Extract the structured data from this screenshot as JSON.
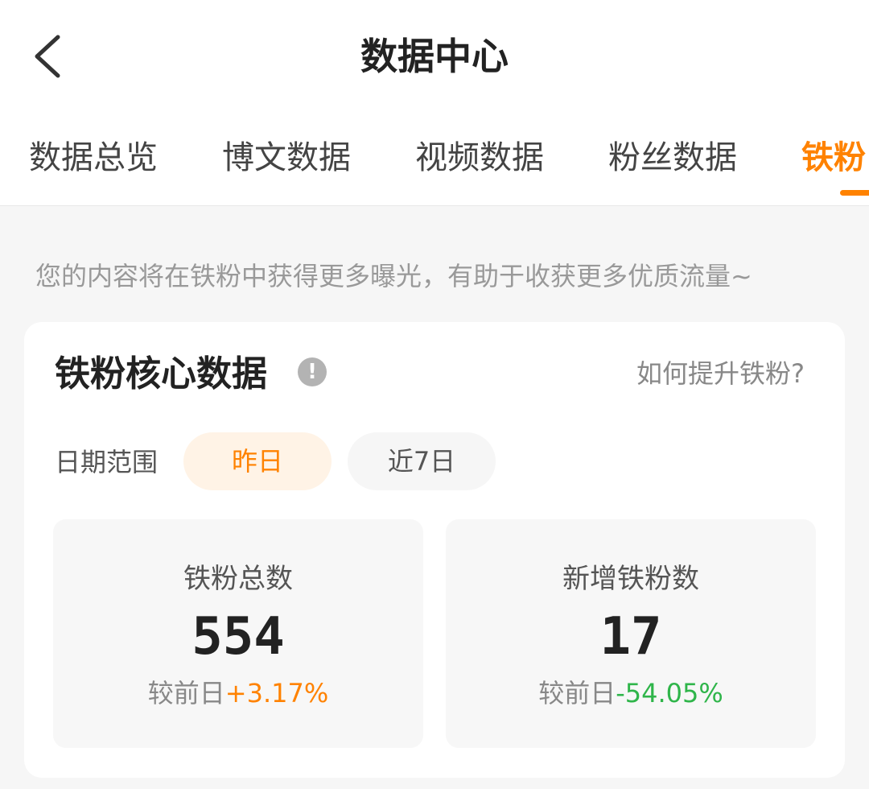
{
  "header": {
    "title": "数据中心",
    "back_icon": "chevron-left-icon"
  },
  "tabs": [
    {
      "label": "数据总览",
      "active": false
    },
    {
      "label": "博文数据",
      "active": false
    },
    {
      "label": "视频数据",
      "active": false
    },
    {
      "label": "粉丝数据",
      "active": false
    },
    {
      "label": "铁粉",
      "active": true
    }
  ],
  "notice": "您的内容将在铁粉中获得更多曝光，有助于收获更多优质流量~",
  "core_card": {
    "title": "铁粉核心数据",
    "info_icon": "!",
    "help_link": "如何提升铁粉?",
    "date_range_label": "日期范围",
    "date_options": [
      {
        "label": "昨日",
        "selected": true
      },
      {
        "label": "近7日",
        "selected": false
      }
    ],
    "stats": [
      {
        "label": "铁粉总数",
        "value": "554",
        "compare_label": "较前日",
        "delta": "+3.17%"
      },
      {
        "label": "新增铁粉数",
        "value": "17",
        "compare_label": "较前日",
        "delta": "-54.05%"
      }
    ]
  },
  "colors": {
    "accent": "#ff8200",
    "positive": "#ff8200",
    "negative": "#2fb54a",
    "background": "#f6f6f6"
  }
}
